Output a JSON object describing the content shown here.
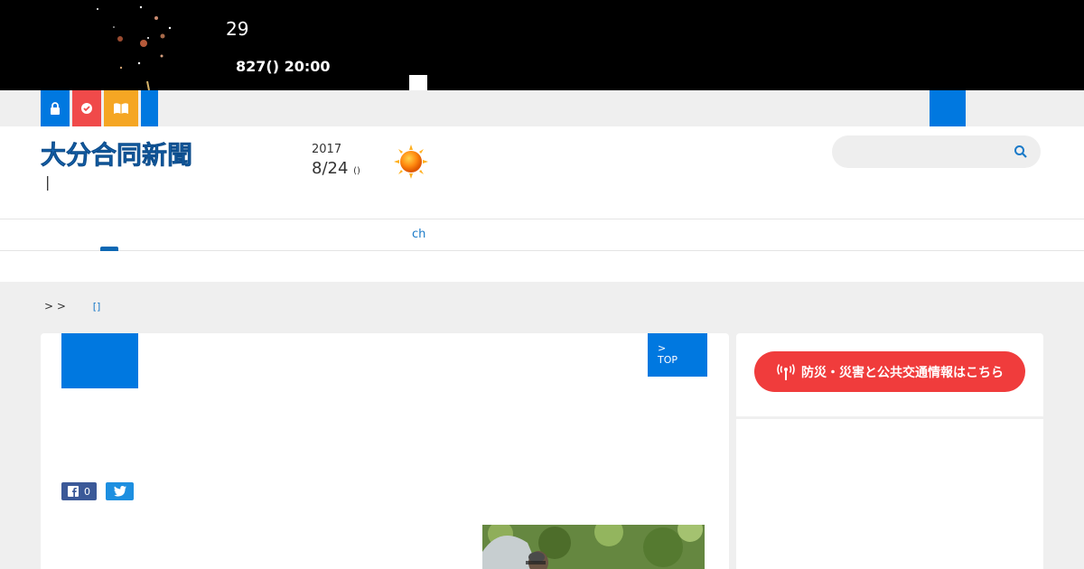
{
  "banner": {
    "number": "29",
    "datetime": "827() 20:00"
  },
  "header": {
    "logo_text": "大分合同新聞",
    "logo_sub": "|",
    "year": "2017",
    "date": "8/24",
    "weekday": "()",
    "weather_icon": "sun-icon",
    "search_placeholder": ""
  },
  "nav": {
    "item_ch": "ch"
  },
  "breadcrumb": {
    "separators": "> >",
    "link": "[]"
  },
  "article": {
    "top_button_line1": ">",
    "top_button_line2": "TOP",
    "fb_count": "0"
  },
  "sidebar": {
    "disaster_button": "防災・災害と公共交通情報はこちら"
  },
  "colors": {
    "brand_blue": "#0078e0",
    "alert_red": "#f03c3c",
    "orange": "#f5a623"
  }
}
